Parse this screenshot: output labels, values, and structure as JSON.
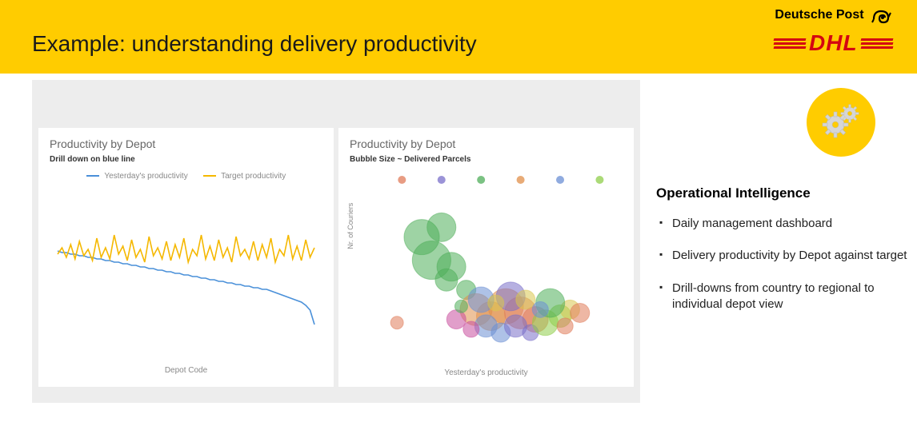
{
  "header": {
    "title": "Example: understanding delivery productivity",
    "brand_top": "Deutsche Post",
    "brand_bottom": "DHL"
  },
  "right": {
    "section_title": "Operational Intelligence",
    "bullets": [
      "Daily management dashboard",
      "Delivery productivity by Depot against target",
      "Drill-downs from country to regional to individual depot view"
    ]
  },
  "chart_left": {
    "title": "Productivity by Depot",
    "subtitle": "Drill down on blue line",
    "legend_a": "Yesterday's productivity",
    "legend_b": "Target productivity",
    "xlabel": "Depot Code"
  },
  "chart_right": {
    "title": "Productivity by Depot",
    "subtitle": "Bubble Size ~ Delivered Parcels",
    "xlabel": "Yesterday's productivity",
    "ylabel": "Nr. of Couriers"
  },
  "colors": {
    "blue": "#4a90d9",
    "yellow": "#f5b800",
    "bubble": [
      "#e07b5a",
      "#7a6fc9",
      "#4fae5a",
      "#e08f4a",
      "#6b8fd4",
      "#8fce4a",
      "#c94f9e",
      "#d9c64f"
    ]
  },
  "chart_data": [
    {
      "type": "line",
      "title": "Productivity by Depot",
      "subtitle": "Drill down on blue line",
      "xlabel": "Depot Code",
      "ylabel": "",
      "ylim": [
        0,
        100
      ],
      "x": [
        1,
        2,
        3,
        4,
        5,
        6,
        7,
        8,
        9,
        10,
        11,
        12,
        13,
        14,
        15,
        16,
        17,
        18,
        19,
        20,
        21,
        22,
        23,
        24,
        25,
        26,
        27,
        28,
        29,
        30,
        31,
        32,
        33,
        34,
        35,
        36,
        37,
        38,
        39,
        40,
        41,
        42,
        43,
        44,
        45,
        46,
        47,
        48,
        49,
        50,
        51,
        52,
        53,
        54,
        55,
        56,
        57,
        58,
        59,
        60
      ],
      "series": [
        {
          "name": "Yesterday's productivity",
          "color": "#4a90d9",
          "values": [
            64,
            63,
            63,
            62,
            62,
            61,
            61,
            60,
            60,
            59,
            59,
            58,
            58,
            57,
            57,
            56,
            56,
            55,
            55,
            54,
            54,
            53,
            53,
            52,
            52,
            51,
            51,
            50,
            50,
            49,
            49,
            48,
            48,
            47,
            47,
            46,
            46,
            45,
            45,
            44,
            44,
            43,
            43,
            42,
            42,
            41,
            41,
            40,
            40,
            39,
            38,
            37,
            36,
            35,
            34,
            33,
            32,
            30,
            27,
            18
          ]
        },
        {
          "name": "Target productivity",
          "color": "#f5b800",
          "values": [
            62,
            66,
            60,
            68,
            59,
            70,
            61,
            65,
            58,
            72,
            60,
            66,
            59,
            74,
            62,
            67,
            58,
            71,
            60,
            65,
            57,
            73,
            61,
            66,
            59,
            70,
            58,
            68,
            60,
            72,
            57,
            65,
            61,
            74,
            59,
            67,
            58,
            71,
            60,
            66,
            57,
            73,
            61,
            65,
            59,
            70,
            58,
            68,
            60,
            72,
            57,
            65,
            61,
            74,
            59,
            67,
            58,
            71,
            60,
            66
          ]
        }
      ],
      "legend": [
        "Yesterday's productivity",
        "Target productivity"
      ]
    },
    {
      "type": "scatter",
      "title": "Productivity by Depot",
      "subtitle": "Bubble Size ~ Delivered Parcels",
      "xlabel": "Yesterday's productivity",
      "ylabel": "Nr. of Couriers",
      "xlim": [
        0,
        100
      ],
      "ylim": [
        0,
        100
      ],
      "size_encodes": "Delivered Parcels",
      "series": [
        {
          "name": "depots",
          "points": [
            {
              "x": 22,
              "y": 72,
              "r": 22,
              "c": "#4fae5a"
            },
            {
              "x": 30,
              "y": 78,
              "r": 18,
              "c": "#4fae5a"
            },
            {
              "x": 26,
              "y": 58,
              "r": 24,
              "c": "#4fae5a"
            },
            {
              "x": 34,
              "y": 54,
              "r": 18,
              "c": "#4fae5a"
            },
            {
              "x": 32,
              "y": 46,
              "r": 14,
              "c": "#4fae5a"
            },
            {
              "x": 40,
              "y": 40,
              "r": 12,
              "c": "#4fae5a"
            },
            {
              "x": 12,
              "y": 20,
              "r": 8,
              "c": "#e07b5a"
            },
            {
              "x": 44,
              "y": 28,
              "r": 20,
              "c": "#e08f4a"
            },
            {
              "x": 50,
              "y": 24,
              "r": 18,
              "c": "#e08f4a"
            },
            {
              "x": 56,
              "y": 30,
              "r": 22,
              "c": "#e08f4a"
            },
            {
              "x": 62,
              "y": 26,
              "r": 20,
              "c": "#e07b5a"
            },
            {
              "x": 68,
              "y": 22,
              "r": 16,
              "c": "#e07b5a"
            },
            {
              "x": 48,
              "y": 18,
              "r": 14,
              "c": "#6b8fd4"
            },
            {
              "x": 54,
              "y": 14,
              "r": 12,
              "c": "#6b8fd4"
            },
            {
              "x": 60,
              "y": 18,
              "r": 14,
              "c": "#7a6fc9"
            },
            {
              "x": 66,
              "y": 14,
              "r": 10,
              "c": "#7a6fc9"
            },
            {
              "x": 72,
              "y": 20,
              "r": 16,
              "c": "#8fce4a"
            },
            {
              "x": 78,
              "y": 24,
              "r": 14,
              "c": "#8fce4a"
            },
            {
              "x": 82,
              "y": 28,
              "r": 12,
              "c": "#d9c64f"
            },
            {
              "x": 74,
              "y": 32,
              "r": 18,
              "c": "#4fae5a"
            },
            {
              "x": 46,
              "y": 34,
              "r": 16,
              "c": "#6b8fd4"
            },
            {
              "x": 58,
              "y": 36,
              "r": 18,
              "c": "#7a6fc9"
            },
            {
              "x": 36,
              "y": 22,
              "r": 12,
              "c": "#c94f9e"
            },
            {
              "x": 42,
              "y": 16,
              "r": 10,
              "c": "#c94f9e"
            },
            {
              "x": 52,
              "y": 32,
              "r": 10,
              "c": "#d9c64f"
            },
            {
              "x": 64,
              "y": 34,
              "r": 12,
              "c": "#d9c64f"
            },
            {
              "x": 70,
              "y": 28,
              "r": 10,
              "c": "#6b8fd4"
            },
            {
              "x": 80,
              "y": 18,
              "r": 10,
              "c": "#e07b5a"
            },
            {
              "x": 86,
              "y": 26,
              "r": 12,
              "c": "#e07b5a"
            },
            {
              "x": 38,
              "y": 30,
              "r": 8,
              "c": "#4fae5a"
            }
          ]
        }
      ],
      "legend_markers": [
        {
          "x": 14,
          "c": "#e07b5a"
        },
        {
          "x": 30,
          "c": "#7a6fc9"
        },
        {
          "x": 46,
          "c": "#4fae5a"
        },
        {
          "x": 62,
          "c": "#e08f4a"
        },
        {
          "x": 78,
          "c": "#6b8fd4"
        },
        {
          "x": 94,
          "c": "#8fce4a"
        }
      ]
    }
  ]
}
